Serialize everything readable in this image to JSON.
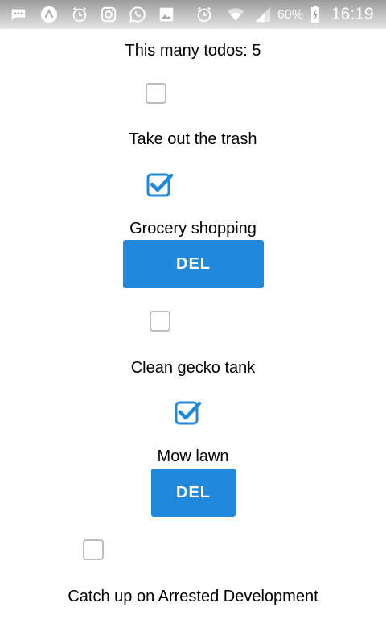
{
  "status_bar": {
    "icons": [
      "messages-icon",
      "app-icon",
      "alarm-icon",
      "instagram-icon",
      "whatsapp-icon",
      "gallery-icon",
      "alarm-clock-icon",
      "wifi-icon",
      "battery-charging-icon"
    ],
    "battery_percent": "60%",
    "time": "16:19"
  },
  "header": {
    "count_label": "This many todos: 5"
  },
  "todos": [
    {
      "label": "Take out the trash",
      "checked": false
    },
    {
      "label": "Grocery shopping",
      "checked": true,
      "delete_label": "DEL"
    },
    {
      "label": "Clean gecko tank",
      "checked": false
    },
    {
      "label": "Mow lawn",
      "checked": true,
      "delete_label": "DEL"
    },
    {
      "label": "Catch up on Arrested Development",
      "checked": false
    }
  ],
  "colors": {
    "accent": "#2089dc",
    "checkbox_border": "#bdbdbd",
    "status_bar": "#b0b0b0"
  }
}
